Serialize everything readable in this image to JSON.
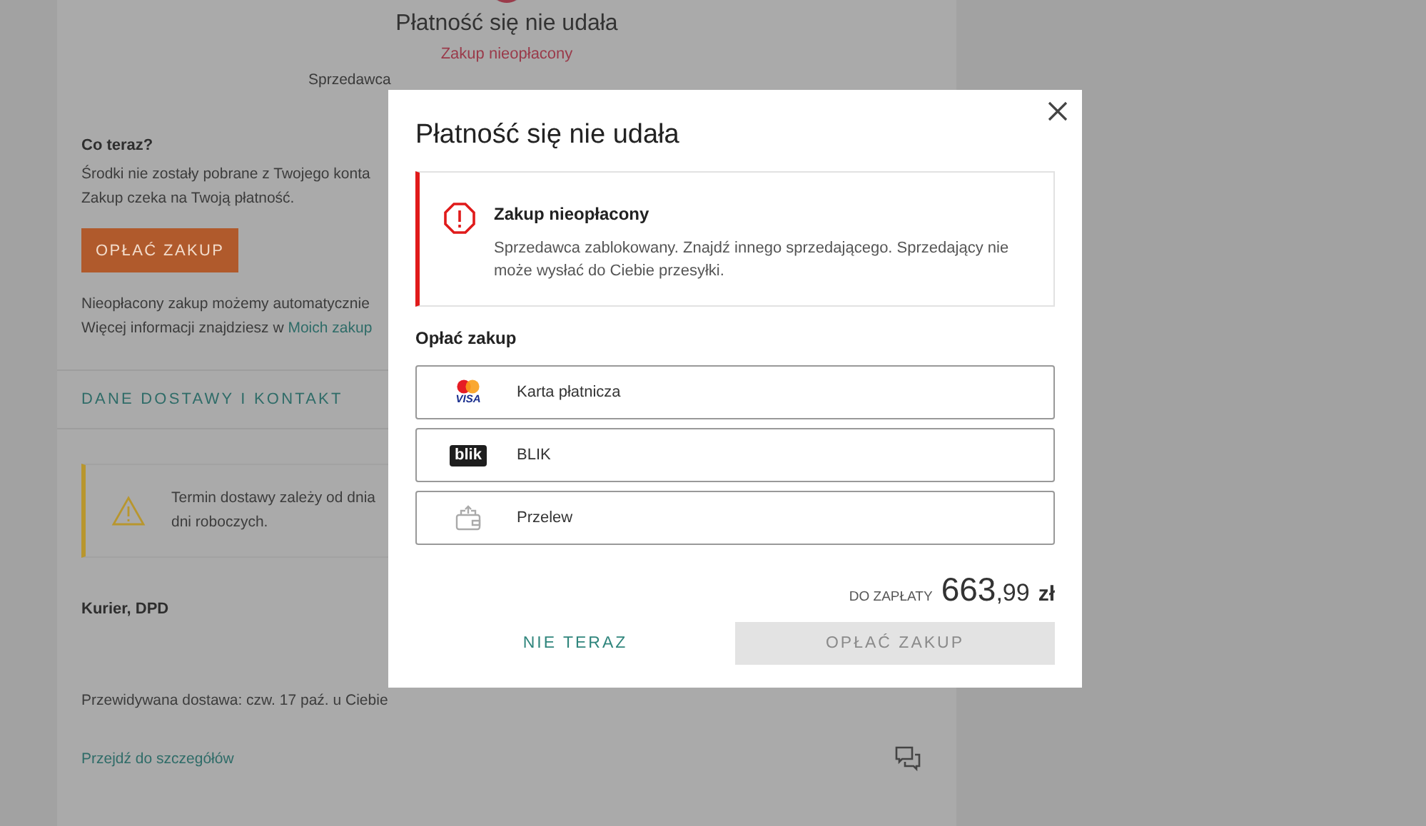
{
  "background_page": {
    "title": "Płatność się nie udała",
    "status": "Zakup nieopłacony",
    "seller_note": "Sprzedawca",
    "next_steps": {
      "heading": "Co teraz?",
      "lines": [
        "Środki nie zostały pobrane z Twojego konta",
        "Zakup czeka na Twoją płatność."
      ],
      "button": "OPŁAĆ ZAKUP",
      "note": "Nieopłacony zakup możemy automatycznie",
      "more_info": {
        "text": "Więcej informacji znajdziesz w ",
        "link": "Moich zakup"
      }
    },
    "delivery_section": {
      "heading": "DANE DOSTAWY I KONTAKT",
      "warning_lines": [
        "Termin dostawy zależy od dnia",
        "dni roboczych."
      ],
      "carrier": "Kurier, DPD",
      "estimate": "Przewidywana dostawa: czw. 17 paź. u Ciebie",
      "details_link": "Przejdź do szczegółów"
    }
  },
  "dialog": {
    "title": "Płatność się nie udała",
    "alert": {
      "title": "Zakup nieopłacony",
      "message": "Sprzedawca zablokowany. Znajdź innego sprzedającego. Sprzedający nie może wysłać do Ciebie przesyłki."
    },
    "section_title": "Opłać zakup",
    "payment_methods": [
      {
        "kind": "card",
        "label": "Karta płatnicza",
        "logo_text": "VISA"
      },
      {
        "kind": "blik",
        "label": "BLIK",
        "logo_text": "blik"
      },
      {
        "kind": "transfer",
        "label": "Przelew"
      }
    ],
    "total": {
      "label": "DO ZAPŁATY",
      "amount": "663",
      "decimals": ",99",
      "currency": "zł"
    },
    "secondary_button": "NIE TERAZ",
    "primary_button": {
      "label": "OPŁAĆ ZAKUP",
      "disabled": true
    }
  }
}
